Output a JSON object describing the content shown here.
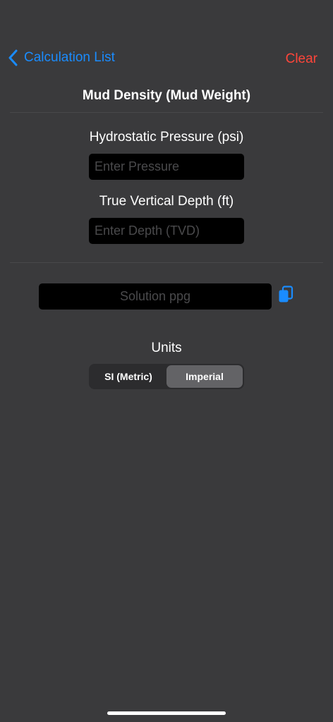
{
  "nav": {
    "back_label": "Calculation List",
    "clear_label": "Clear"
  },
  "page": {
    "title": "Mud Density (Mud Weight)"
  },
  "form": {
    "pressure_label": "Hydrostatic Pressure (psi)",
    "pressure_value": "",
    "pressure_placeholder": "Enter Pressure",
    "depth_label": "True Vertical Depth (ft)",
    "depth_value": "",
    "depth_placeholder": "Enter Depth (TVD)"
  },
  "solution": {
    "value": "",
    "placeholder": "Solution ppg",
    "copy_icon": "copy-icon"
  },
  "units": {
    "label": "Units",
    "options": [
      "SI (Metric)",
      "Imperial"
    ],
    "selected": "Imperial"
  },
  "colors": {
    "background": "#3a3a3c",
    "accent": "#1a8cff",
    "destructive": "#ff453a",
    "field_background": "#000000"
  }
}
